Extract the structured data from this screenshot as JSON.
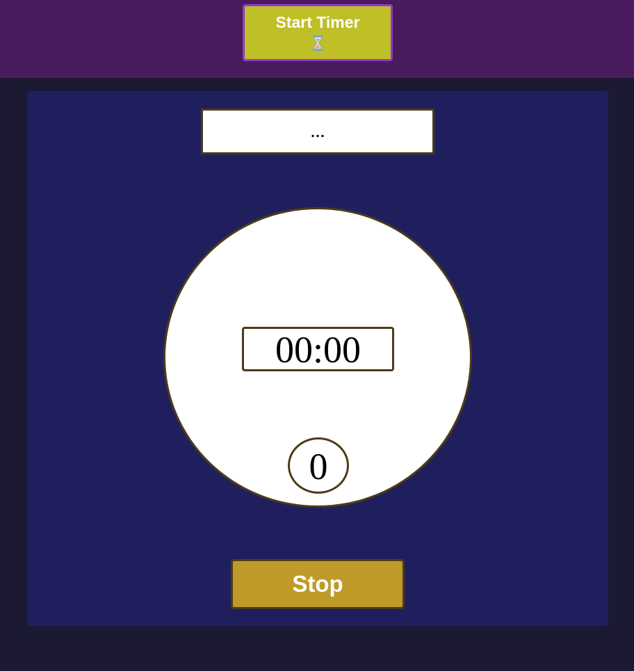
{
  "header": {
    "start_button": {
      "label": "Start Timer",
      "icon": "hourglass-icon"
    }
  },
  "main": {
    "message": "...",
    "timer": {
      "time": "00:00",
      "count": "0"
    },
    "stop_button": {
      "label": "Stop"
    }
  },
  "colors": {
    "header_bg": "#4a1a5e",
    "page_bg": "#1c1a33",
    "panel_bg": "#201f5e",
    "start_button_bg": "#bfbf28",
    "start_button_border": "#8e3cc8",
    "stop_button_bg": "#c09a28",
    "border": "#4d3b17"
  }
}
